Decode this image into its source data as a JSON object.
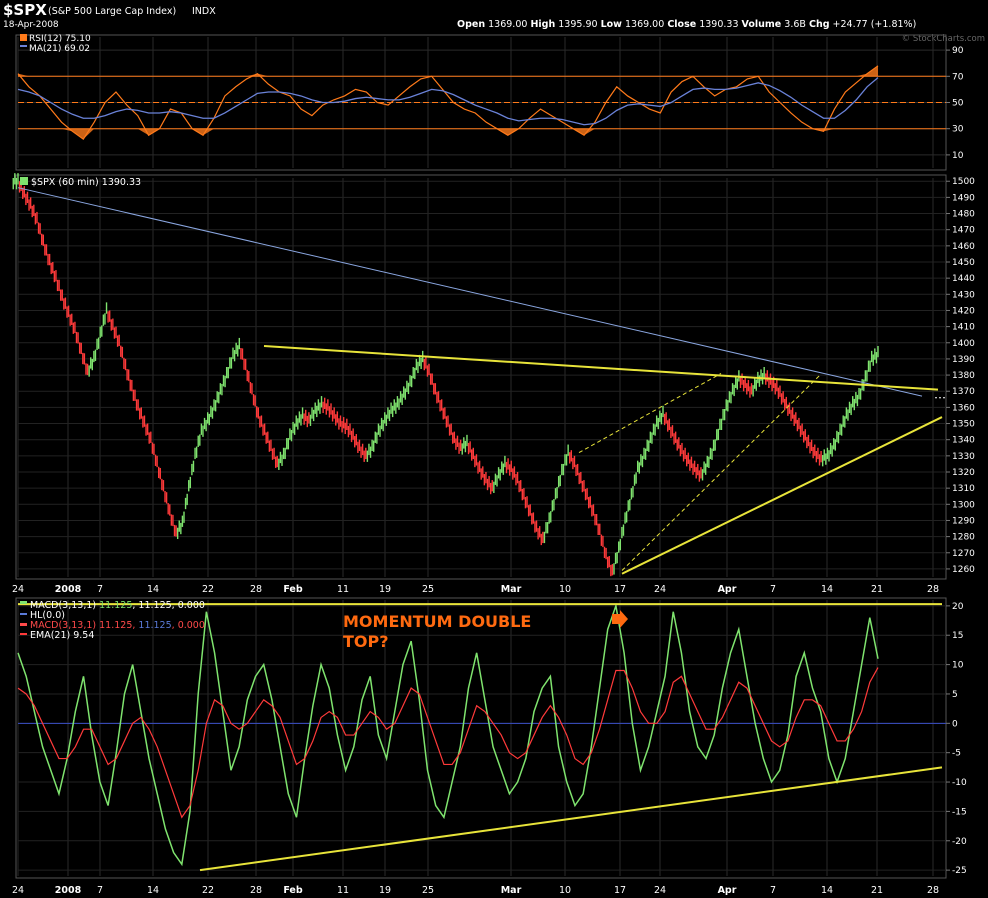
{
  "header": {
    "symbol": "$SPX",
    "name": "(S&P 500 Large Cap Index)",
    "exchange": "INDX",
    "date": "18-Apr-2008",
    "open_label": "Open",
    "open": "1369.00",
    "high_label": "High",
    "high": "1395.90",
    "low_label": "Low",
    "low": "1369.00",
    "close_label": "Close",
    "close": "1390.33",
    "volume_label": "Volume",
    "volume": "3.6B",
    "chg_label": "Chg",
    "chg": "+24.77 (+1.81%)",
    "watermark": "© StockCharts.com"
  },
  "chart_data": [
    {
      "type": "line",
      "panel": "rsi",
      "legend": [
        "RSI(12) 75.10",
        "MA(21) 69.02"
      ],
      "ylim": [
        0,
        100
      ],
      "yticks": [
        10,
        30,
        50,
        70,
        90
      ],
      "overbought": 70,
      "oversold": 30,
      "midline": 50,
      "series": [
        {
          "name": "RSI(12)",
          "color": "#ff7a1a",
          "values": [
            72,
            62,
            55,
            45,
            35,
            28,
            22,
            35,
            50,
            58,
            48,
            40,
            25,
            30,
            45,
            42,
            30,
            25,
            38,
            55,
            62,
            68,
            72,
            64,
            58,
            55,
            45,
            40,
            48,
            52,
            55,
            60,
            58,
            50,
            48,
            55,
            62,
            68,
            70,
            60,
            50,
            45,
            42,
            35,
            30,
            25,
            30,
            38,
            45,
            40,
            35,
            30,
            25,
            35,
            50,
            62,
            55,
            50,
            45,
            42,
            58,
            66,
            70,
            62,
            55,
            60,
            62,
            68,
            70,
            58,
            50,
            42,
            35,
            30,
            28,
            45,
            58,
            65,
            72,
            78
          ]
        },
        {
          "name": "MA(21)",
          "color": "#6a82d8",
          "values": [
            60,
            58,
            55,
            50,
            45,
            41,
            38,
            38,
            40,
            43,
            45,
            44,
            42,
            42,
            43,
            42,
            40,
            38,
            38,
            42,
            47,
            52,
            57,
            58,
            58,
            57,
            55,
            52,
            50,
            50,
            51,
            53,
            54,
            53,
            52,
            52,
            54,
            57,
            60,
            59,
            56,
            52,
            48,
            45,
            42,
            38,
            36,
            37,
            38,
            38,
            37,
            35,
            33,
            34,
            38,
            44,
            48,
            49,
            48,
            47,
            50,
            55,
            60,
            61,
            60,
            60,
            61,
            63,
            65,
            63,
            59,
            54,
            48,
            43,
            38,
            38,
            44,
            52,
            62,
            69
          ]
        }
      ]
    },
    {
      "type": "bar",
      "panel": "price",
      "legend": [
        "$SPX (60 min) 1390.33"
      ],
      "ylim": [
        1255,
        1502
      ],
      "yticks": [
        1260,
        1270,
        1280,
        1290,
        1300,
        1310,
        1320,
        1330,
        1340,
        1350,
        1360,
        1370,
        1380,
        1390,
        1400,
        1410,
        1420,
        1430,
        1440,
        1450,
        1460,
        1470,
        1480,
        1490,
        1500
      ],
      "series": [
        {
          "name": "$SPX",
          "values": [
            1500,
            1492,
            1485,
            1476,
            1462,
            1450,
            1440,
            1428,
            1418,
            1408,
            1395,
            1382,
            1390,
            1405,
            1420,
            1410,
            1400,
            1385,
            1372,
            1360,
            1350,
            1340,
            1325,
            1310,
            1295,
            1282,
            1288,
            1310,
            1330,
            1345,
            1352,
            1360,
            1370,
            1380,
            1392,
            1398,
            1385,
            1370,
            1355,
            1345,
            1335,
            1325,
            1330,
            1342,
            1350,
            1355,
            1352,
            1358,
            1362,
            1360,
            1355,
            1350,
            1348,
            1342,
            1335,
            1330,
            1335,
            1345,
            1352,
            1358,
            1362,
            1368,
            1375,
            1385,
            1390,
            1382,
            1370,
            1360,
            1350,
            1340,
            1335,
            1338,
            1330,
            1322,
            1315,
            1310,
            1318,
            1325,
            1322,
            1315,
            1305,
            1295,
            1285,
            1278,
            1290,
            1305,
            1320,
            1332,
            1325,
            1315,
            1305,
            1295,
            1283,
            1268,
            1258,
            1272,
            1290,
            1305,
            1322,
            1330,
            1340,
            1350,
            1356,
            1348,
            1340,
            1333,
            1327,
            1322,
            1318,
            1325,
            1335,
            1348,
            1360,
            1370,
            1378,
            1374,
            1370,
            1377,
            1380,
            1376,
            1372,
            1365,
            1358,
            1352,
            1345,
            1338,
            1332,
            1328,
            1330,
            1336,
            1345,
            1355,
            1362,
            1367,
            1378,
            1390,
            1393
          ]
        }
      ],
      "annotations": [
        {
          "kind": "trendline",
          "color": "#8aa6e0",
          "from": [
            "Jan 24",
            1496
          ],
          "to": [
            "Apr 21",
            1367
          ]
        },
        {
          "kind": "resistance",
          "color": "#e8e43a",
          "from": [
            "Jan 29",
            1398
          ],
          "to": [
            "Apr 24",
            1371
          ]
        },
        {
          "kind": "support",
          "color": "#e8e43a",
          "from": [
            "Mar 17",
            1257
          ],
          "to": [
            "Apr 28",
            1354
          ]
        },
        {
          "kind": "channel-upper",
          "color": "#e8e43a",
          "style": "dashed",
          "from": [
            "Mar 11",
            1332
          ],
          "to": [
            "Apr 1",
            1381
          ]
        },
        {
          "kind": "channel-lower",
          "color": "#e8e43a",
          "style": "dashed",
          "from": [
            "Mar 17",
            1259
          ],
          "to": [
            "Apr 9",
            1380
          ]
        }
      ]
    },
    {
      "type": "line",
      "panel": "macd",
      "legend": [
        {
          "text": "MACD(3,13,1) ",
          "color": "#ffffff"
        },
        {
          "text": "11.125",
          "color": "#7fe36e"
        },
        {
          "text": ", 11.125, 0.000",
          "color": "#ffffff"
        }
      ],
      "legend2": "HL(0.0)",
      "legend3": [
        {
          "text": "MACD(3,13,1) 11.125, ",
          "color": "#ff4a4a"
        },
        {
          "text": "11.125",
          "color": "#5a7ad8"
        },
        {
          "text": ", 0.000",
          "color": "#ff4a4a"
        }
      ],
      "legend4": "EMA(21) 9.54",
      "annotation_text": [
        "MOMENTUM DOUBLE",
        "TOP?"
      ],
      "ylim": [
        -26,
        21
      ],
      "yticks": [
        -25,
        -20,
        -15,
        -10,
        -5,
        0,
        5,
        10,
        15,
        20
      ],
      "series": [
        {
          "name": "MACD",
          "color": "#7fe36e",
          "values": [
            12,
            8,
            2,
            -4,
            -8,
            -12,
            -6,
            2,
            8,
            -2,
            -10,
            -14,
            -5,
            5,
            10,
            2,
            -6,
            -12,
            -18,
            -22,
            -24,
            -15,
            5,
            19,
            12,
            2,
            -8,
            -4,
            4,
            8,
            10,
            4,
            -4,
            -12,
            -16,
            -6,
            3,
            10,
            6,
            -2,
            -8,
            -4,
            4,
            8,
            -2,
            -6,
            2,
            10,
            14,
            4,
            -8,
            -14,
            -16,
            -10,
            -4,
            6,
            12,
            4,
            -4,
            -8,
            -12,
            -10,
            -6,
            2,
            6,
            8,
            -4,
            -10,
            -14,
            -12,
            -4,
            6,
            16,
            20,
            12,
            0,
            -8,
            -4,
            2,
            8,
            19,
            12,
            2,
            -4,
            -6,
            -2,
            6,
            12,
            16,
            8,
            0,
            -6,
            -10,
            -8,
            -2,
            8,
            12,
            6,
            2,
            -6,
            -10,
            -6,
            2,
            10,
            18,
            11
          ]
        },
        {
          "name": "EMA(21)",
          "color": "#ff3a3a",
          "values": [
            6,
            5,
            3,
            0,
            -3,
            -6,
            -6,
            -4,
            -1,
            -1,
            -4,
            -7,
            -6,
            -3,
            0,
            1,
            -1,
            -4,
            -8,
            -12,
            -16,
            -14,
            -8,
            0,
            4,
            3,
            0,
            -1,
            0,
            2,
            4,
            3,
            1,
            -3,
            -7,
            -6,
            -3,
            1,
            2,
            1,
            -2,
            -2,
            0,
            2,
            1,
            -1,
            0,
            3,
            6,
            5,
            1,
            -3,
            -7,
            -7,
            -5,
            -1,
            3,
            2,
            0,
            -2,
            -5,
            -6,
            -5,
            -2,
            1,
            3,
            1,
            -2,
            -6,
            -7,
            -5,
            -1,
            4,
            9,
            9,
            6,
            2,
            0,
            0,
            2,
            7,
            8,
            5,
            2,
            -1,
            -1,
            1,
            4,
            7,
            6,
            3,
            0,
            -3,
            -4,
            -3,
            1,
            4,
            4,
            3,
            0,
            -3,
            -3,
            -1,
            2,
            7,
            9.5
          ]
        }
      ],
      "annotations": [
        {
          "kind": "resistance",
          "color": "#e8e43a",
          "from": [
            "Jan 24",
            20.3
          ],
          "to": [
            "Apr 28",
            20.3
          ]
        },
        {
          "kind": "support",
          "color": "#e8e43a",
          "from": [
            "Feb 21",
            -25
          ],
          "to": [
            "Apr 28",
            -7.5
          ]
        }
      ]
    }
  ],
  "x_axis": {
    "labels": [
      "24",
      "2008",
      "7",
      "14",
      "22",
      "28",
      "Feb",
      "11",
      "19",
      "25",
      "Mar",
      "10",
      "17",
      "24",
      "Apr",
      "7",
      "14",
      "21",
      "28"
    ]
  }
}
